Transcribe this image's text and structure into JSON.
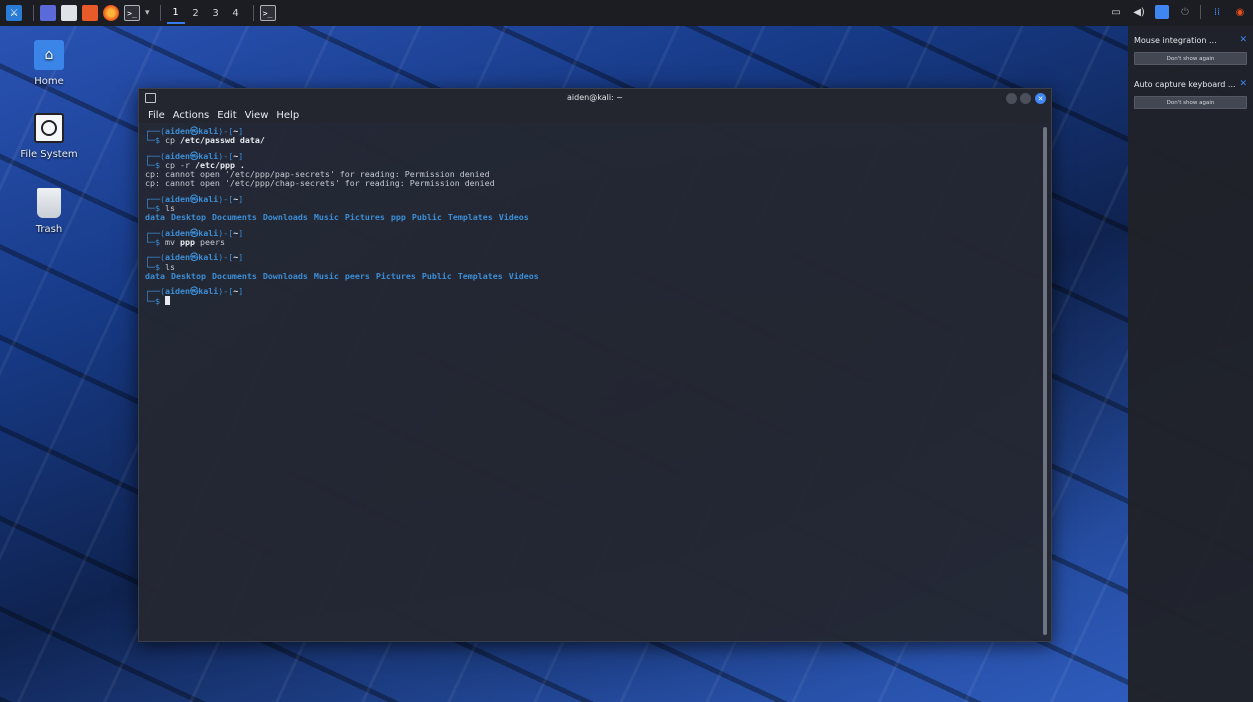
{
  "taskbar": {
    "workspaces": [
      "1",
      "2",
      "3",
      "4"
    ],
    "active_workspace": "1"
  },
  "desktop": {
    "icons": [
      {
        "label": "Home",
        "icon": "home-icon"
      },
      {
        "label": "File System",
        "icon": "drive-icon"
      },
      {
        "label": "Trash",
        "icon": "trash-icon"
      }
    ]
  },
  "terminal": {
    "title": "aiden@kali: ~",
    "menu": [
      "File",
      "Actions",
      "Edit",
      "View",
      "Help"
    ],
    "prompt": {
      "frame_top": "┌──(",
      "user": "aiden㉿kali",
      "mid": ")-[",
      "dir": "~",
      "end": "]",
      "frame_bottom": "└─",
      "symbol": "$ "
    },
    "blocks": [
      {
        "cmd_name": "cp",
        "cmd_args": " /etc/passwd data/",
        "cmd_style": "bold",
        "output": []
      },
      {
        "cmd_name": "cp -r",
        "cmd_args": " /etc/ppp .",
        "cmd_style": "bold",
        "output": [
          "cp: cannot open '/etc/ppp/pap-secrets' for reading: Permission denied",
          "cp: cannot open '/etc/ppp/chap-secrets' for reading: Permission denied"
        ]
      },
      {
        "cmd_name": "ls",
        "cmd_args": "",
        "cmd_style": "plain",
        "ls": [
          "data",
          "Desktop",
          "Documents",
          "Downloads",
          "Music",
          "Pictures",
          "ppp",
          "Public",
          "Templates",
          "Videos"
        ]
      },
      {
        "cmd_name": "mv",
        "cmd_args": " ppp",
        "cmd_tail": " peers",
        "cmd_style": "bold",
        "output": []
      },
      {
        "cmd_name": "ls",
        "cmd_args": "",
        "cmd_style": "plain",
        "ls": [
          "data",
          "Desktop",
          "Documents",
          "Downloads",
          "Music",
          "peers",
          "Pictures",
          "Public",
          "Templates",
          "Videos"
        ]
      }
    ]
  },
  "notifications": [
    {
      "title": "Mouse integration ...",
      "button": "Don't show again"
    },
    {
      "title": "Auto capture keyboard ...",
      "button": "Don't show again"
    }
  ],
  "colors": {
    "accent": "#367bf0",
    "prompt": "#3c8ed6",
    "terminal_bg": "#242832"
  }
}
